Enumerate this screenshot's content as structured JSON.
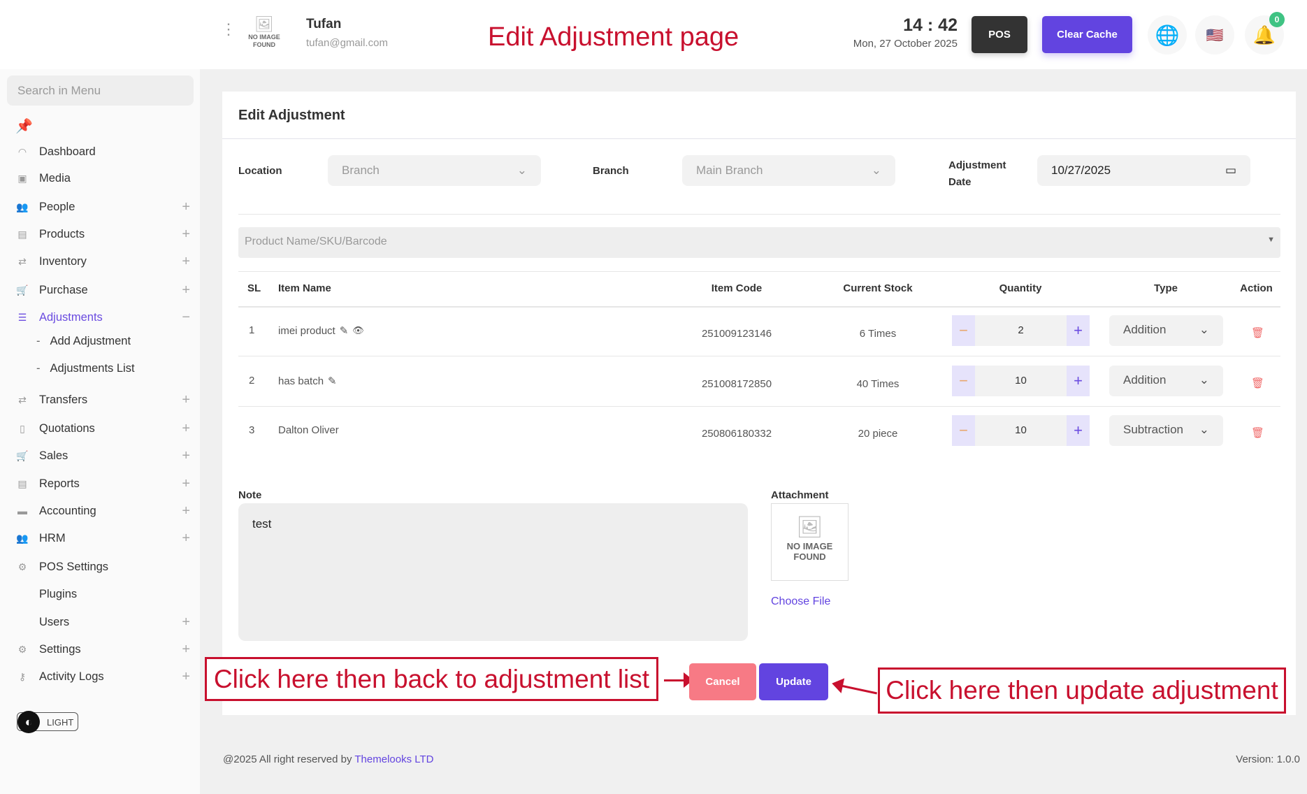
{
  "header": {
    "user_name": "Tufan",
    "user_email": "tufan@gmail.com",
    "avatar_text": "NO IMAGE FOUND",
    "time": "14 : 42",
    "date": "Mon, 27 October 2025",
    "pos_label": "POS",
    "clear_cache_label": "Clear Cache",
    "notification_count": "0"
  },
  "annotation_title": "Edit Adjustment page",
  "sidebar": {
    "search_placeholder": "Search in Menu",
    "items": [
      {
        "label": "Dashboard",
        "icon": "dashboard-icon",
        "glyph": "◠",
        "plus": false
      },
      {
        "label": "Media",
        "icon": "media-icon",
        "glyph": "▣",
        "plus": false
      },
      {
        "label": "People",
        "icon": "people-icon",
        "glyph": "👥",
        "plus": true
      },
      {
        "label": "Products",
        "icon": "products-icon",
        "glyph": "▤",
        "plus": true
      },
      {
        "label": "Inventory",
        "icon": "inventory-icon",
        "glyph": "⇄",
        "plus": true
      },
      {
        "label": "Purchase",
        "icon": "cart-icon",
        "glyph": "🛒",
        "plus": true
      },
      {
        "label": "Adjustments",
        "icon": "sliders-icon",
        "glyph": "☰",
        "plus": false,
        "minus": true,
        "active": true
      },
      {
        "label": "Add Adjustment",
        "sub": true
      },
      {
        "label": "Adjustments List",
        "sub": true
      },
      {
        "label": "Transfers",
        "icon": "transfer-icon",
        "glyph": "⇄",
        "plus": true
      },
      {
        "label": "Quotations",
        "icon": "document-icon",
        "glyph": "▯",
        "plus": true
      },
      {
        "label": "Sales",
        "icon": "cart-icon",
        "glyph": "🛒",
        "plus": true
      },
      {
        "label": "Reports",
        "icon": "report-icon",
        "glyph": "▤",
        "plus": true
      },
      {
        "label": "Accounting",
        "icon": "briefcase-icon",
        "glyph": "▬",
        "plus": true
      },
      {
        "label": "HRM",
        "icon": "users-icon",
        "glyph": "👥",
        "plus": true
      },
      {
        "label": "POS Settings",
        "icon": "gears-icon",
        "glyph": "⚙",
        "plus": false
      },
      {
        "label": "Plugins",
        "plus": false
      },
      {
        "label": "Users",
        "plus": true
      },
      {
        "label": "Settings",
        "icon": "gear-icon",
        "glyph": "⚙",
        "plus": true
      },
      {
        "label": "Activity Logs",
        "icon": "key-icon",
        "glyph": "⚷",
        "plus": true
      }
    ],
    "theme_toggle": "LIGHT"
  },
  "form": {
    "title": "Edit Adjustment",
    "location_label": "Location",
    "location_value": "Branch",
    "branch_label": "Branch",
    "branch_value": "Main Branch",
    "date_label_1": "Adjustment",
    "date_label_2": "Date",
    "date_value": "10/27/2025",
    "product_search_placeholder": "Product Name/SKU/Barcode",
    "columns": [
      "SL",
      "Item Name",
      "Item Code",
      "Current Stock",
      "Quantity",
      "Type",
      "Action"
    ],
    "rows": [
      {
        "sl": "1",
        "name": "imei product",
        "edit": true,
        "view": true,
        "code": "251009123146",
        "stock": "6 Times",
        "qty": "2",
        "type": "Addition"
      },
      {
        "sl": "2",
        "name": "has batch",
        "edit": true,
        "view": false,
        "code": "251008172850",
        "stock": "40 Times",
        "qty": "10",
        "type": "Addition"
      },
      {
        "sl": "3",
        "name": "Dalton Oliver",
        "edit": false,
        "view": false,
        "code": "250806180332",
        "stock": "20 piece",
        "qty": "10",
        "type": "Subtraction"
      }
    ],
    "note_label": "Note",
    "note_value": "test",
    "attachment_label": "Attachment",
    "attachment_placeholder": "NO IMAGE FOUND",
    "choose_file": "Choose File",
    "cancel_label": "Cancel",
    "update_label": "Update"
  },
  "annotations": {
    "cancel": "Click here then back to adjustment list",
    "update": "Click here then update adjustment"
  },
  "footer": {
    "copyright": "@2025 All right reserved by ",
    "company": "Themelooks LTD",
    "version": "Version: 1.0.0"
  },
  "colors": {
    "accent": "#6244e0",
    "cancel": "#f77a85",
    "annotation": "#c8102e"
  }
}
